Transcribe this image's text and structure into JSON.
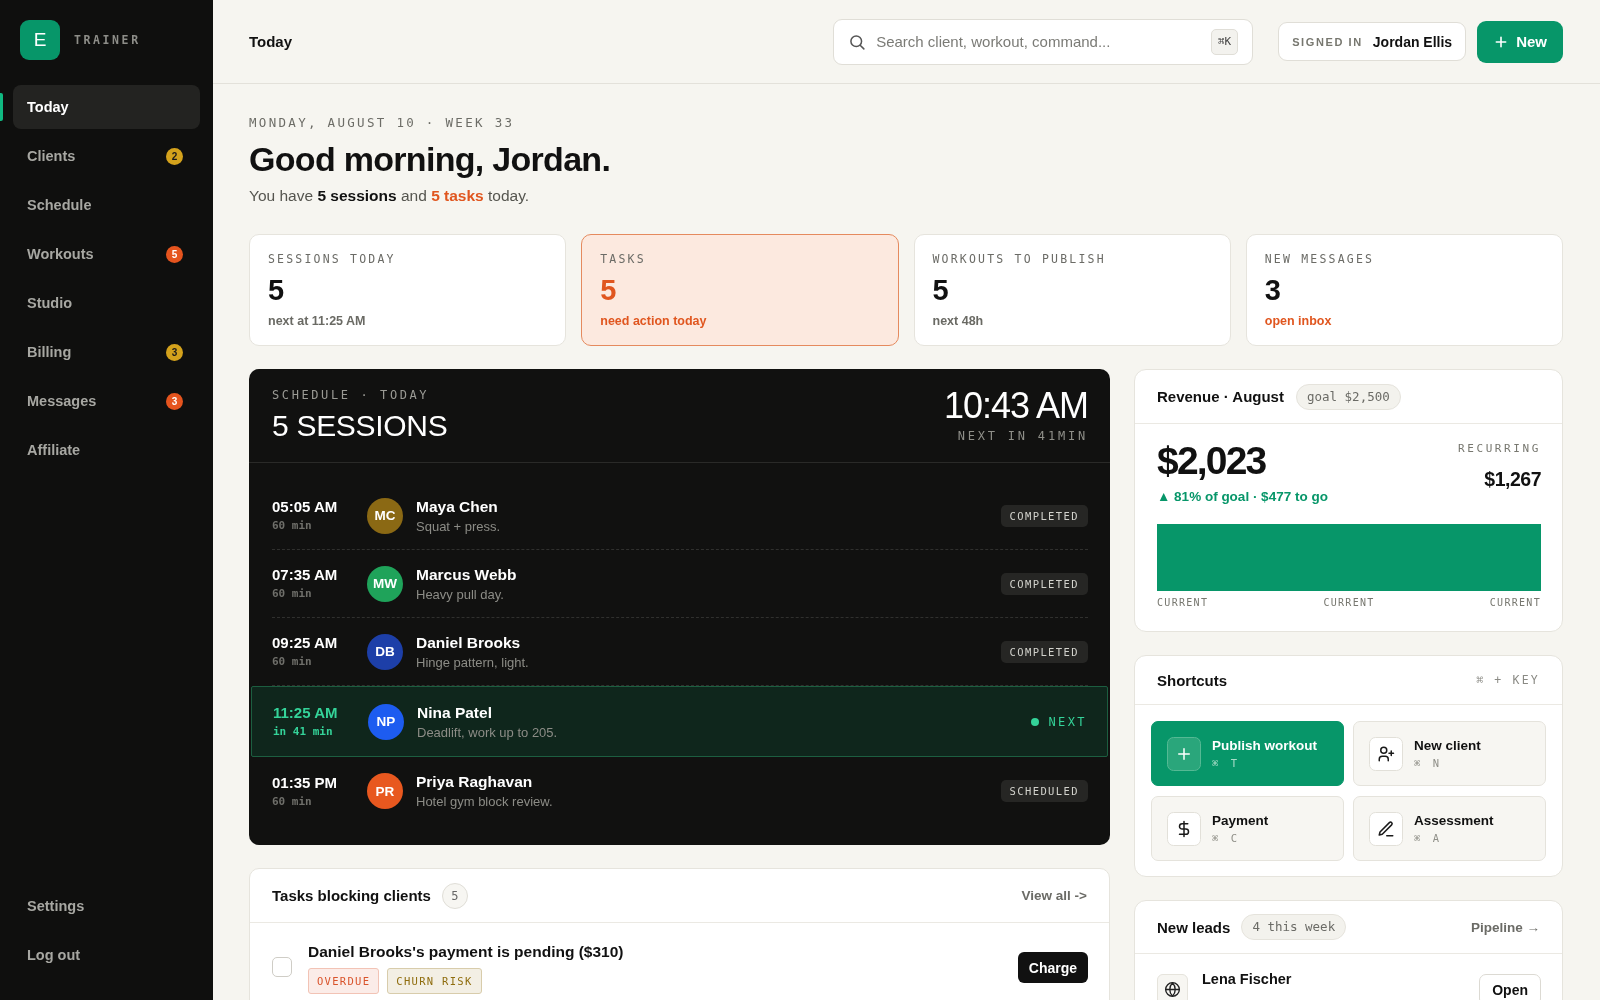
{
  "sidebar": {
    "logo": "E",
    "brand": "TRAINER",
    "items": [
      {
        "label": "Today",
        "selected": true
      },
      {
        "label": "Clients",
        "selected": false,
        "badge": {
          "count": "2",
          "color": "#d4a21c"
        }
      },
      {
        "label": "Schedule",
        "selected": false
      },
      {
        "label": "Workouts",
        "selected": false,
        "badge": {
          "count": "5",
          "color": "#e5541e"
        }
      },
      {
        "label": "Studio",
        "selected": false
      },
      {
        "label": "Billing",
        "selected": false,
        "badge": {
          "count": "3",
          "color": "#d4a21c"
        }
      },
      {
        "label": "Messages",
        "selected": false,
        "badge": {
          "count": "3",
          "color": "#e5541e"
        }
      },
      {
        "label": "Affiliate",
        "selected": false
      }
    ],
    "footer_items": [
      "Settings",
      "Log out"
    ]
  },
  "topbar": {
    "title": "Today",
    "search": {
      "placeholder": "Search client, workout, command...",
      "shortcut": "⌘K"
    },
    "signed_in": {
      "label": "SIGNED IN",
      "name": "Jordan Ellis"
    },
    "new_button": "New"
  },
  "greeting": {
    "date": "MONDAY, AUGUST 10 · WEEK 33",
    "title": "Good morning, Jordan.",
    "summary": [
      {
        "kind": "plain",
        "text": "You have "
      },
      {
        "kind": "strong",
        "text": "5 sessions"
      },
      {
        "kind": "plain",
        "text": " and "
      },
      {
        "kind": "alert",
        "text": "5 tasks"
      },
      {
        "kind": "plain",
        "text": " today."
      }
    ]
  },
  "stats": [
    {
      "label": "SESSIONS TODAY",
      "value": "5",
      "note": "next at 11:25 AM",
      "highlighted": false,
      "note_accent": false
    },
    {
      "label": "TASKS",
      "value": "5",
      "note": "need action today",
      "highlighted": true,
      "note_accent": true
    },
    {
      "label": "WORKOUTS TO PUBLISH",
      "value": "5",
      "note": "next 48h",
      "highlighted": false,
      "note_accent": false
    },
    {
      "label": "NEW MESSAGES",
      "value": "3",
      "note": "open inbox",
      "highlighted": false,
      "note_accent": true
    }
  ],
  "schedule": {
    "eyebrow": "SCHEDULE · TODAY",
    "title": "5 SESSIONS",
    "clock": "10:43 AM",
    "countdown": "NEXT IN 41MIN",
    "sessions": [
      {
        "time": "05:05 AM",
        "duration": "60 min",
        "initials": "MC",
        "color": "#8b6914",
        "name": "Maya Chen",
        "note": "Squat + press.",
        "status": "COMPLETED",
        "current": false
      },
      {
        "time": "07:35 AM",
        "duration": "60 min",
        "initials": "MW",
        "color": "#1fa35a",
        "name": "Marcus Webb",
        "note": "Heavy pull day.",
        "status": "COMPLETED",
        "current": false
      },
      {
        "time": "09:25 AM",
        "duration": "60 min",
        "initials": "DB",
        "color": "#1d3fa8",
        "name": "Daniel Brooks",
        "note": "Hinge pattern, light.",
        "status": "COMPLETED",
        "current": false
      },
      {
        "time": "11:25 AM",
        "duration": "in 41 min",
        "initials": "NP",
        "color": "#1d5cf0",
        "name": "Nina Patel",
        "note": "Deadlift, work up to 205.",
        "status": "NEXT",
        "current": true
      },
      {
        "time": "01:35 PM",
        "duration": "60 min",
        "initials": "PR",
        "color": "#e8581f",
        "name": "Priya Raghavan",
        "note": "Hotel gym block review.",
        "status": "SCHEDULED",
        "current": false
      }
    ]
  },
  "revenue": {
    "title": "Revenue · August",
    "goal": "goal $2,500",
    "amount": "$2,023",
    "progress": "▲ 81% of goal · $477 to go",
    "recurring_label": "RECURRING",
    "recurring": "$1,267",
    "axis_labels": [
      "CURRENT",
      "CURRENT",
      "CURRENT"
    ]
  },
  "shortcuts": {
    "title": "Shortcuts",
    "hint": "⌘ + KEY",
    "items": [
      {
        "label": "Publish workout",
        "keys": "⌘ T",
        "primary": true
      },
      {
        "label": "New client",
        "keys": "⌘ N",
        "primary": false
      },
      {
        "label": "Payment",
        "keys": "⌘ C",
        "primary": false
      },
      {
        "label": "Assessment",
        "keys": "⌘ A",
        "primary": false
      }
    ]
  },
  "tasks": {
    "title": "Tasks blocking clients",
    "count": "5",
    "link": "View all ->",
    "items": [
      {
        "title": "Daniel Brooks's payment is pending ($310)",
        "checked": false,
        "tags": [
          {
            "label": "OVERDUE",
            "color": "#d9532b"
          },
          {
            "label": "CHURN RISK",
            "color": "#8f6d0e"
          }
        ],
        "action": "Charge"
      }
    ]
  },
  "leads": {
    "title": "New leads",
    "count": "4 this week",
    "link": "Pipeline →",
    "items": [
      {
        "name": "Lena Fischer",
        "action": "Open"
      }
    ]
  }
}
